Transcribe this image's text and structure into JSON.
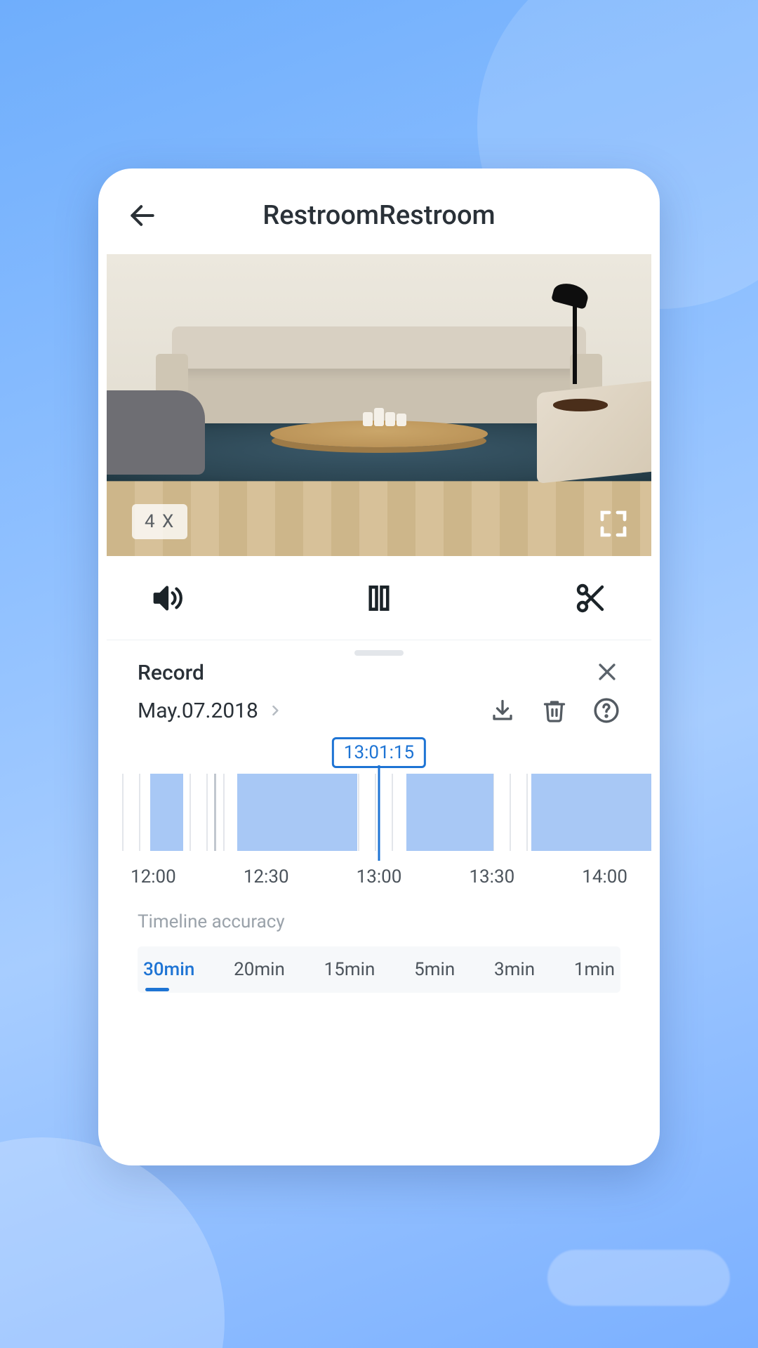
{
  "header": {
    "title": "RestroomRestroom"
  },
  "video": {
    "zoom_label": "4 X"
  },
  "controls": {
    "sound_icon": "sound-icon",
    "pause_icon": "pause-icon",
    "cut_icon": "scissors-icon"
  },
  "record_panel": {
    "label": "Record",
    "date": "May.07.2018",
    "current_time": "13:01:15"
  },
  "timeline": {
    "marks": [
      "12:00",
      "12:30",
      "13:00",
      "13:30",
      "14:00"
    ],
    "segments": [
      {
        "left_pct": 8,
        "width_pct": 6
      },
      {
        "left_pct": 24,
        "width_pct": 22
      },
      {
        "left_pct": 55,
        "width_pct": 16
      },
      {
        "left_pct": 78,
        "width_pct": 22
      }
    ]
  },
  "accuracy": {
    "title": "Timeline accuracy",
    "options": [
      "30min",
      "20min",
      "15min",
      "5min",
      "3min",
      "1min"
    ],
    "active_index": 0
  }
}
